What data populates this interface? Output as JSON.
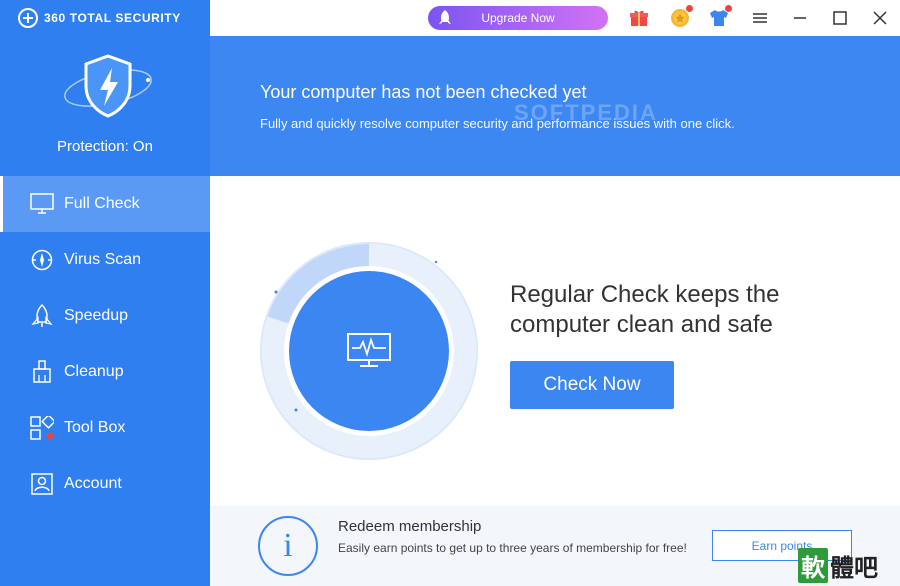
{
  "app": {
    "brand": "360 TOTAL SECURITY"
  },
  "sidebar": {
    "protection_status": "Protection: On",
    "items": [
      {
        "label": "Full Check",
        "icon": "monitor-icon",
        "active": true
      },
      {
        "label": "Virus Scan",
        "icon": "compass-scan-icon",
        "active": false
      },
      {
        "label": "Speedup",
        "icon": "rocket-icon",
        "active": false
      },
      {
        "label": "Cleanup",
        "icon": "broom-icon",
        "active": false
      },
      {
        "label": "Tool Box",
        "icon": "grid-tools-icon",
        "active": false
      },
      {
        "label": "Account",
        "icon": "user-card-icon",
        "active": false
      }
    ]
  },
  "topbar": {
    "upgrade_label": "Upgrade Now",
    "icons": [
      "gift-icon",
      "coin-icon",
      "tshirt-icon",
      "menu-icon",
      "minimize-icon",
      "maximize-icon",
      "close-icon"
    ]
  },
  "banner": {
    "title": "Your computer has not been checked yet",
    "subtitle": "Fully and quickly resolve computer security and performance issues with one click.",
    "watermark": "SOFTPEDIA"
  },
  "main": {
    "headline": "Regular Check keeps the computer clean and safe",
    "check_button": "Check Now"
  },
  "membership": {
    "title": "Redeem membership",
    "subtitle": "Easily earn points to get up to three years of membership for free!",
    "earn_button": "Earn points"
  },
  "corner_logo": {
    "char1": "軟",
    "chars_rest": "體吧"
  },
  "colors": {
    "sidebar": "#2f7ff0",
    "sidebar_active": "#5a9af5",
    "banner": "#3d87f3",
    "accent": "#3b86f1",
    "upgrade_start": "#7b55f0",
    "upgrade_end": "#d272f5"
  }
}
